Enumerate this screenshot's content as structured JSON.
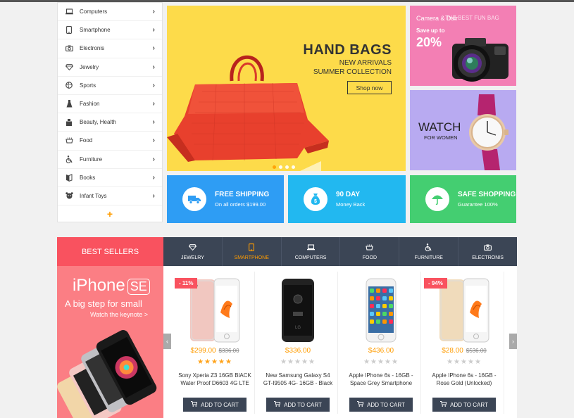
{
  "sidebar": {
    "items": [
      {
        "label": "Computers",
        "icon": "laptop-icon"
      },
      {
        "label": "Smartphone",
        "icon": "phone-icon"
      },
      {
        "label": "Electronis",
        "icon": "camera-icon"
      },
      {
        "label": "Jewelry",
        "icon": "diamond-icon"
      },
      {
        "label": "Sports",
        "icon": "ball-icon"
      },
      {
        "label": "Fashion",
        "icon": "dress-icon"
      },
      {
        "label": "Beauty, Health",
        "icon": "cosmetics-icon"
      },
      {
        "label": "Food",
        "icon": "food-icon"
      },
      {
        "label": "Furniture",
        "icon": "wheelchair-icon"
      },
      {
        "label": "Books",
        "icon": "book-icon"
      },
      {
        "label": "Infant Toys",
        "icon": "toy-icon"
      }
    ],
    "more_symbol": "+"
  },
  "main_banner": {
    "title": "HAND BAGS",
    "line1": "NEW ARRIVALS",
    "line2": "SUMMER COLLECTION",
    "button": "Shop now"
  },
  "camera_banner": {
    "title": "Camera & Dslr",
    "overlay_text": "THE BEST FUN BAG",
    "save_label": "Save up to",
    "percent": "20%"
  },
  "watch_banner": {
    "title": "WATCH",
    "subtitle": "FOR WOMEN"
  },
  "services": [
    {
      "title": "FREE SHIPPING",
      "subtitle": "On all orders $199.00",
      "icon": "truck-icon",
      "color": "#2e9df4"
    },
    {
      "title": "90 DAY",
      "subtitle": "Money Back",
      "icon": "money-bag-icon",
      "color": "#22b8f0"
    },
    {
      "title": "SAFE SHOPPING",
      "subtitle": "Guarantee 100%",
      "icon": "umbrella-icon",
      "color": "#44ce71"
    }
  ],
  "best_sellers": {
    "header": "BEST SELLERS",
    "promo_title": "iPhone",
    "promo_badge": "SE",
    "promo_tagline": "A big step for small",
    "promo_link": "Watch the keynote >"
  },
  "tabs": [
    {
      "label": "JEWELRY",
      "icon": "diamond-icon",
      "active": false
    },
    {
      "label": "SMARTPHONE",
      "icon": "phone-icon",
      "active": true
    },
    {
      "label": "COMPUTERS",
      "icon": "laptop-icon",
      "active": false
    },
    {
      "label": "FOOD",
      "icon": "food-icon",
      "active": false
    },
    {
      "label": "FURNITURE",
      "icon": "wheelchair-icon",
      "active": false
    },
    {
      "label": "ELECTRONIS",
      "icon": "camera-icon",
      "active": false
    }
  ],
  "products": [
    {
      "discount": "- 11%",
      "price": "$299.00",
      "old_price": "$336.00",
      "stars": "★★★★★",
      "rated": true,
      "name": "Sony Xperia Z3 16GB BlACK Water Proof D6603 4G LTE",
      "cart": "ADD TO CART",
      "phone": "rose"
    },
    {
      "discount": "",
      "price": "$336.00",
      "old_price": "",
      "stars": "★★★★★",
      "rated": false,
      "name": "New Samsung Galaxy S4 GT-I9505 4G- 16GB - Black",
      "cart": "ADD TO CART",
      "phone": "black"
    },
    {
      "discount": "",
      "price": "$436.00",
      "old_price": "",
      "stars": "★★★★★",
      "rated": false,
      "name": "Apple IPhone 6s - 16GB - Space Grey Smartphone",
      "cart": "ADD TO CART",
      "phone": "white"
    },
    {
      "discount": "- 94%",
      "price": "$28.00",
      "old_price": "$536.00",
      "stars": "★★★★★",
      "rated": false,
      "name": "Apple IPhone 6s - 16GB - Rose Gold (Unlocked)",
      "cart": "ADD TO CART",
      "phone": "gold"
    }
  ],
  "nav": {
    "prev": "‹",
    "next": "›"
  }
}
